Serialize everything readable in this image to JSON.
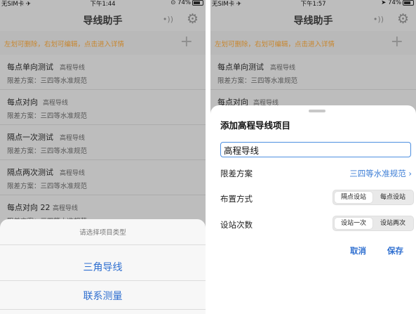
{
  "left": {
    "status": {
      "carrier": "无SIM卡 ✈",
      "time": "下午1:44",
      "battery": "74%"
    },
    "nav": {
      "title": "导线助手"
    },
    "hint": "左划可删除，右划可编辑，点击进入详情",
    "items": [
      {
        "name": "每点单向测试",
        "tag": "高程导线",
        "sub": "限差方案：三四等水准规范"
      },
      {
        "name": "每点对向",
        "tag": "高程导线",
        "sub": "限差方案：三四等水准规范"
      },
      {
        "name": "隔点一次测试",
        "tag": "高程导线",
        "sub": "限差方案：三四等水准规范"
      },
      {
        "name": "隔点两次测试",
        "tag": "高程导线",
        "sub": "限差方案：三四等水准规范"
      },
      {
        "name": "每点对向 22",
        "tag": "高程导线",
        "sub": "限差方案：三四等水准规范"
      }
    ],
    "sheet": {
      "title": "请选择项目类型",
      "options": [
        "三角导线",
        "联系测量"
      ]
    }
  },
  "right": {
    "status": {
      "carrier": "无SIM卡 ✈",
      "time": "下午1:57",
      "battery": "74%"
    },
    "nav": {
      "title": "导线助手"
    },
    "hint": "左划可删除，右划可编辑，点击进入详情",
    "items": [
      {
        "name": "每点单向测试",
        "tag": "高程导线",
        "sub": "限差方案：三四等水准规范"
      },
      {
        "name": "每点对向",
        "tag": "高程导线"
      }
    ],
    "modal": {
      "title": "添加高程导线项目",
      "name_value": "高程导线",
      "scheme_label": "限差方案",
      "scheme_value": "三四等水准规范",
      "layout_label": "布置方式",
      "layout_options": [
        "隔点设站",
        "每点设站"
      ],
      "stations_label": "设站次数",
      "stations_options": [
        "设站一次",
        "设站两次"
      ],
      "cancel": "取消",
      "save": "保存"
    }
  },
  "colors": {
    "accent": "#2f6fd0",
    "hint": "#c8862e",
    "dim_background": "#bdbdbd"
  }
}
